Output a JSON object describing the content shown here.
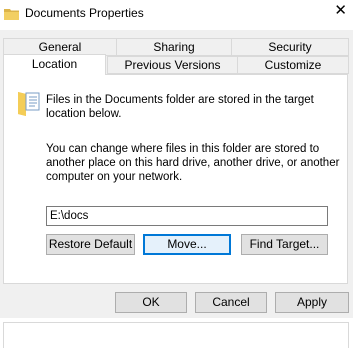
{
  "window": {
    "title": "Documents Properties",
    "close_glyph": "✕",
    "icon": "folder-icon"
  },
  "tabs_row1": [
    {
      "label": "General"
    },
    {
      "label": "Sharing"
    },
    {
      "label": "Security"
    }
  ],
  "tabs_row2": [
    {
      "label": "Location",
      "active": true
    },
    {
      "label": "Previous Versions"
    },
    {
      "label": "Customize"
    }
  ],
  "location": {
    "info_line1": "Files in the Documents folder are stored in the target",
    "info_line2": "location below.",
    "desc_line1": "You can change where files in this folder are stored to",
    "desc_line2": "another place on this hard drive, another drive, or another",
    "desc_line3": "computer on your network.",
    "path_value": "E:\\docs",
    "restore_default_label": "Restore Default",
    "move_label": "Move...",
    "find_target_label": "Find Target..."
  },
  "footer": {
    "ok_label": "OK",
    "cancel_label": "Cancel",
    "apply_label": "Apply"
  },
  "colors": {
    "dialog_bg": "#f0f0f0",
    "focus_accent": "#0078d7",
    "button_bg": "#e1e1e1"
  }
}
